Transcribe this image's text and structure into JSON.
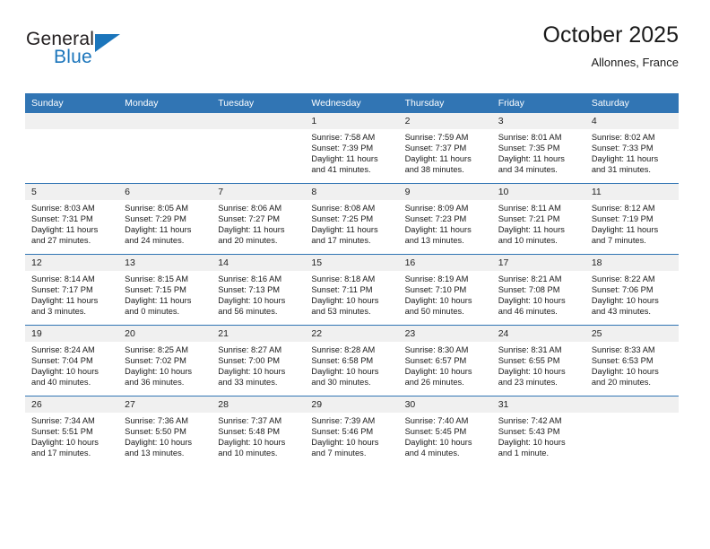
{
  "brand": {
    "name_part1": "General",
    "name_part2": "Blue",
    "logo_icon": "blue-triangle-icon"
  },
  "header": {
    "title": "October 2025",
    "subtitle": "Allonnes, France"
  },
  "colors": {
    "header_blue": "#3175b4",
    "brand_blue": "#1b75bb",
    "daynum_band": "#f0f0f0",
    "text": "#1a1a1a"
  },
  "calendar": {
    "weekday_headers": [
      "Sunday",
      "Monday",
      "Tuesday",
      "Wednesday",
      "Thursday",
      "Friday",
      "Saturday"
    ],
    "weeks": [
      [
        {
          "day": "",
          "lines": []
        },
        {
          "day": "",
          "lines": []
        },
        {
          "day": "",
          "lines": []
        },
        {
          "day": "1",
          "lines": [
            "Sunrise: 7:58 AM",
            "Sunset: 7:39 PM",
            "Daylight: 11 hours",
            "and 41 minutes."
          ]
        },
        {
          "day": "2",
          "lines": [
            "Sunrise: 7:59 AM",
            "Sunset: 7:37 PM",
            "Daylight: 11 hours",
            "and 38 minutes."
          ]
        },
        {
          "day": "3",
          "lines": [
            "Sunrise: 8:01 AM",
            "Sunset: 7:35 PM",
            "Daylight: 11 hours",
            "and 34 minutes."
          ]
        },
        {
          "day": "4",
          "lines": [
            "Sunrise: 8:02 AM",
            "Sunset: 7:33 PM",
            "Daylight: 11 hours",
            "and 31 minutes."
          ]
        }
      ],
      [
        {
          "day": "5",
          "lines": [
            "Sunrise: 8:03 AM",
            "Sunset: 7:31 PM",
            "Daylight: 11 hours",
            "and 27 minutes."
          ]
        },
        {
          "day": "6",
          "lines": [
            "Sunrise: 8:05 AM",
            "Sunset: 7:29 PM",
            "Daylight: 11 hours",
            "and 24 minutes."
          ]
        },
        {
          "day": "7",
          "lines": [
            "Sunrise: 8:06 AM",
            "Sunset: 7:27 PM",
            "Daylight: 11 hours",
            "and 20 minutes."
          ]
        },
        {
          "day": "8",
          "lines": [
            "Sunrise: 8:08 AM",
            "Sunset: 7:25 PM",
            "Daylight: 11 hours",
            "and 17 minutes."
          ]
        },
        {
          "day": "9",
          "lines": [
            "Sunrise: 8:09 AM",
            "Sunset: 7:23 PM",
            "Daylight: 11 hours",
            "and 13 minutes."
          ]
        },
        {
          "day": "10",
          "lines": [
            "Sunrise: 8:11 AM",
            "Sunset: 7:21 PM",
            "Daylight: 11 hours",
            "and 10 minutes."
          ]
        },
        {
          "day": "11",
          "lines": [
            "Sunrise: 8:12 AM",
            "Sunset: 7:19 PM",
            "Daylight: 11 hours",
            "and 7 minutes."
          ]
        }
      ],
      [
        {
          "day": "12",
          "lines": [
            "Sunrise: 8:14 AM",
            "Sunset: 7:17 PM",
            "Daylight: 11 hours",
            "and 3 minutes."
          ]
        },
        {
          "day": "13",
          "lines": [
            "Sunrise: 8:15 AM",
            "Sunset: 7:15 PM",
            "Daylight: 11 hours",
            "and 0 minutes."
          ]
        },
        {
          "day": "14",
          "lines": [
            "Sunrise: 8:16 AM",
            "Sunset: 7:13 PM",
            "Daylight: 10 hours",
            "and 56 minutes."
          ]
        },
        {
          "day": "15",
          "lines": [
            "Sunrise: 8:18 AM",
            "Sunset: 7:11 PM",
            "Daylight: 10 hours",
            "and 53 minutes."
          ]
        },
        {
          "day": "16",
          "lines": [
            "Sunrise: 8:19 AM",
            "Sunset: 7:10 PM",
            "Daylight: 10 hours",
            "and 50 minutes."
          ]
        },
        {
          "day": "17",
          "lines": [
            "Sunrise: 8:21 AM",
            "Sunset: 7:08 PM",
            "Daylight: 10 hours",
            "and 46 minutes."
          ]
        },
        {
          "day": "18",
          "lines": [
            "Sunrise: 8:22 AM",
            "Sunset: 7:06 PM",
            "Daylight: 10 hours",
            "and 43 minutes."
          ]
        }
      ],
      [
        {
          "day": "19",
          "lines": [
            "Sunrise: 8:24 AM",
            "Sunset: 7:04 PM",
            "Daylight: 10 hours",
            "and 40 minutes."
          ]
        },
        {
          "day": "20",
          "lines": [
            "Sunrise: 8:25 AM",
            "Sunset: 7:02 PM",
            "Daylight: 10 hours",
            "and 36 minutes."
          ]
        },
        {
          "day": "21",
          "lines": [
            "Sunrise: 8:27 AM",
            "Sunset: 7:00 PM",
            "Daylight: 10 hours",
            "and 33 minutes."
          ]
        },
        {
          "day": "22",
          "lines": [
            "Sunrise: 8:28 AM",
            "Sunset: 6:58 PM",
            "Daylight: 10 hours",
            "and 30 minutes."
          ]
        },
        {
          "day": "23",
          "lines": [
            "Sunrise: 8:30 AM",
            "Sunset: 6:57 PM",
            "Daylight: 10 hours",
            "and 26 minutes."
          ]
        },
        {
          "day": "24",
          "lines": [
            "Sunrise: 8:31 AM",
            "Sunset: 6:55 PM",
            "Daylight: 10 hours",
            "and 23 minutes."
          ]
        },
        {
          "day": "25",
          "lines": [
            "Sunrise: 8:33 AM",
            "Sunset: 6:53 PM",
            "Daylight: 10 hours",
            "and 20 minutes."
          ]
        }
      ],
      [
        {
          "day": "26",
          "lines": [
            "Sunrise: 7:34 AM",
            "Sunset: 5:51 PM",
            "Daylight: 10 hours",
            "and 17 minutes."
          ]
        },
        {
          "day": "27",
          "lines": [
            "Sunrise: 7:36 AM",
            "Sunset: 5:50 PM",
            "Daylight: 10 hours",
            "and 13 minutes."
          ]
        },
        {
          "day": "28",
          "lines": [
            "Sunrise: 7:37 AM",
            "Sunset: 5:48 PM",
            "Daylight: 10 hours",
            "and 10 minutes."
          ]
        },
        {
          "day": "29",
          "lines": [
            "Sunrise: 7:39 AM",
            "Sunset: 5:46 PM",
            "Daylight: 10 hours",
            "and 7 minutes."
          ]
        },
        {
          "day": "30",
          "lines": [
            "Sunrise: 7:40 AM",
            "Sunset: 5:45 PM",
            "Daylight: 10 hours",
            "and 4 minutes."
          ]
        },
        {
          "day": "31",
          "lines": [
            "Sunrise: 7:42 AM",
            "Sunset: 5:43 PM",
            "Daylight: 10 hours",
            "and 1 minute."
          ]
        },
        {
          "day": "",
          "lines": []
        }
      ]
    ]
  }
}
